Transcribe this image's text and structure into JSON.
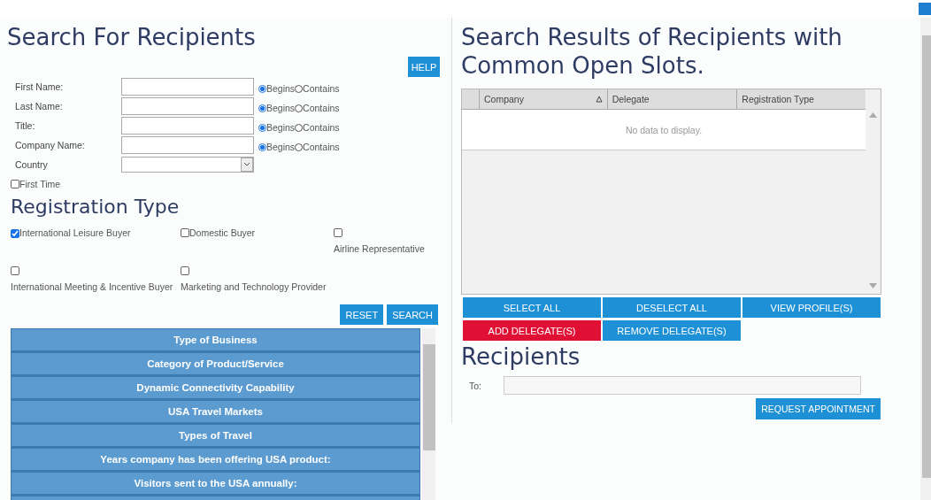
{
  "search": {
    "title": "Search For Recipients",
    "help_button": "HELP",
    "fields": [
      {
        "label": "First Name:",
        "kind": "text",
        "match": [
          {
            "label": "Begins",
            "selected": true
          },
          {
            "label": "Contains",
            "selected": false
          }
        ]
      },
      {
        "label": "Last Name:",
        "kind": "text",
        "match": [
          {
            "label": "Begins",
            "selected": true
          },
          {
            "label": "Contains",
            "selected": false
          }
        ]
      },
      {
        "label": "Title:",
        "kind": "text",
        "match": [
          {
            "label": "Begins",
            "selected": true
          },
          {
            "label": "Contains",
            "selected": false
          }
        ]
      },
      {
        "label": "Company Name:",
        "kind": "text",
        "match": [
          {
            "label": "Begins",
            "selected": true
          },
          {
            "label": "Contains",
            "selected": false
          }
        ]
      },
      {
        "label": "Country",
        "kind": "select"
      }
    ],
    "first_time": {
      "label": "First Time",
      "checked": false
    },
    "registration_title": "Registration Type",
    "registration_types": [
      {
        "label": "International Leisure Buyer",
        "checked": true,
        "kind": "inline"
      },
      {
        "label": "Domestic Buyer",
        "checked": false,
        "kind": "inline"
      },
      {
        "label": "Airline Representative",
        "checked": false,
        "kind": "stacked"
      },
      {
        "label": "International Meeting & Incentive Buyer",
        "checked": false,
        "kind": "stacked"
      },
      {
        "label": "Marketing and Technology Provider",
        "checked": false,
        "kind": "stacked"
      }
    ],
    "buttons": [
      "RESET",
      "SEARCH"
    ],
    "categories": [
      "Type of Business",
      "Category of Product/Service",
      "Dynamic Connectivity Capability",
      "USA Travel Markets",
      "Types of Travel",
      "Years company has been offering USA product:",
      "Visitors sent to the USA annually:"
    ]
  },
  "results": {
    "title": "Search Results of Recipients with Common Open Slots.",
    "columns": [
      {
        "label": "Company",
        "sorted": true
      },
      {
        "label": "Delegate",
        "sorted": false
      },
      {
        "label": "Registration Type",
        "sorted": false
      }
    ],
    "empty_text": "No data to display.",
    "buttons": [
      {
        "label": "SELECT ALL",
        "kind": "primary"
      },
      {
        "label": "DESELECT ALL",
        "kind": "primary"
      },
      {
        "label": "VIEW PROFILE(S)",
        "kind": "primary"
      },
      {
        "label": "ADD DELEGATE(S)",
        "kind": "danger"
      },
      {
        "label": "REMOVE DELEGATE(S)",
        "kind": "primary"
      }
    ]
  },
  "recipients": {
    "title": "Recipients",
    "to_label": "To:",
    "button": "REQUEST APPOINTMENT"
  }
}
